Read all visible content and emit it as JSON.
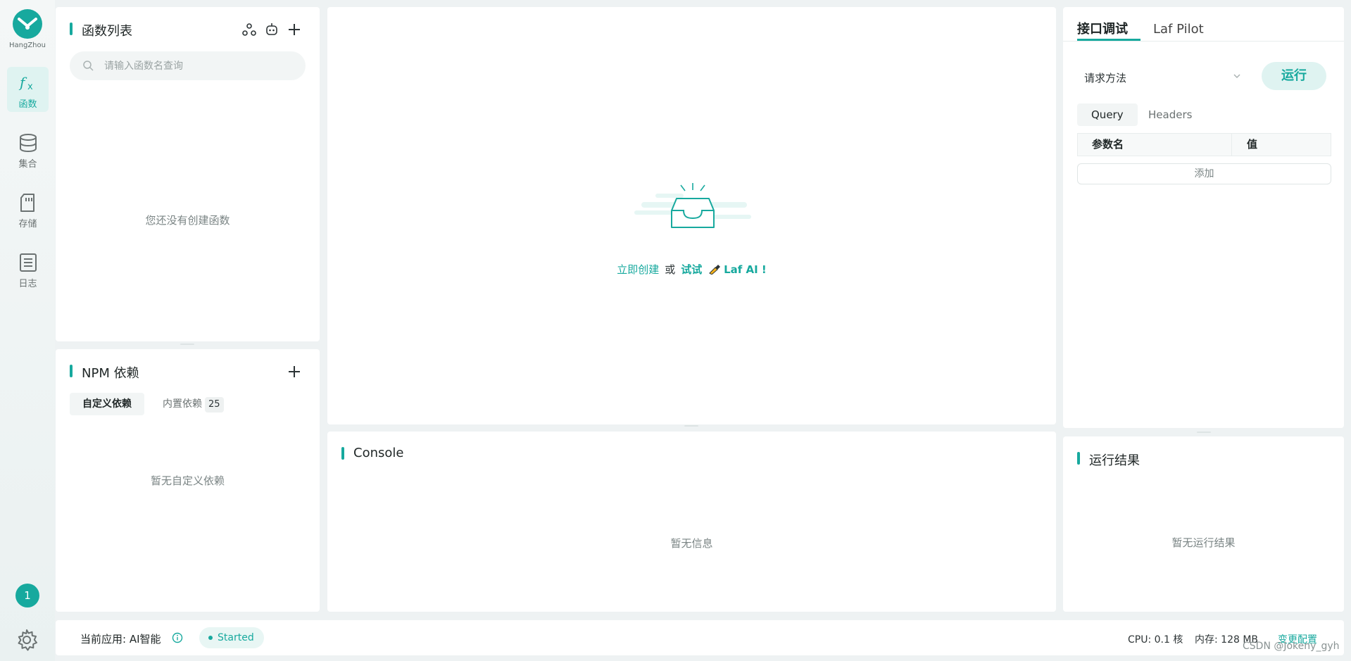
{
  "rail": {
    "region": "HangZhou",
    "nav": [
      {
        "label": "函数",
        "icon": "function-icon",
        "active": true
      },
      {
        "label": "集合",
        "icon": "database-icon",
        "active": false
      },
      {
        "label": "存储",
        "icon": "storage-icon",
        "active": false
      },
      {
        "label": "日志",
        "icon": "log-icon",
        "active": false
      }
    ],
    "notification_count": "1"
  },
  "functions": {
    "title": "函数列表",
    "search_placeholder": "请输入函数名查询",
    "empty_text": "您还没有创建函数"
  },
  "npm": {
    "title": "NPM 依赖",
    "tabs": [
      {
        "label": "自定义依赖",
        "active": true
      },
      {
        "label": "内置依赖",
        "count": "25",
        "active": false
      }
    ],
    "empty_text": "暂无自定义依赖"
  },
  "editor": {
    "create_link": "立即创建",
    "or_text": "或",
    "try_link": "试试",
    "ai_link": "Laf AI !"
  },
  "console": {
    "title": "Console",
    "empty_text": "暂无信息"
  },
  "debug": {
    "tabs": [
      {
        "label": "接口调试",
        "active": true
      },
      {
        "label": "Laf Pilot",
        "active": false
      }
    ],
    "method_label": "请求方法",
    "method_value": "",
    "run_label": "运行",
    "query_tabs": [
      {
        "label": "Query",
        "active": true
      },
      {
        "label": "Headers",
        "active": false
      }
    ],
    "table_headers": [
      "参数名",
      "值"
    ],
    "add_label": "添加"
  },
  "result": {
    "title": "运行结果",
    "empty_text": "暂无运行结果"
  },
  "status": {
    "app_label": "当前应用: AI智能",
    "state": "Started",
    "cpu": "CPU: 0.1 核",
    "memory": "内存: 128 MB",
    "change_config": "变更配置"
  },
  "watermark": "CSDN @Jokeny_gyh",
  "colors": {
    "accent": "#17a99e",
    "background": "#eef2f3"
  }
}
